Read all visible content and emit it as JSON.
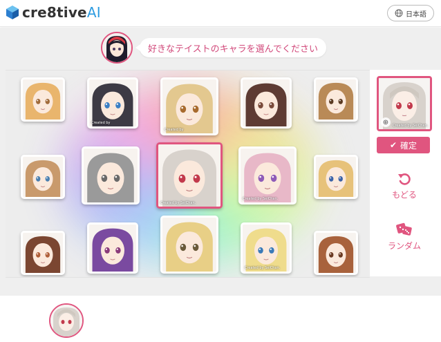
{
  "header": {
    "logo_text": "cre8tive",
    "logo_text_ai": "AI",
    "language_label": "日本語"
  },
  "prompt": {
    "message": "好きなテイストのキャラを選んでください"
  },
  "grid": {
    "cards": [
      {
        "id": "c1",
        "hair": "#e9b56d",
        "eye": "#a06a3a",
        "credit": ""
      },
      {
        "id": "c2",
        "hair": "#3d3a44",
        "eye": "#3b7fc4",
        "credit": "Created by"
      },
      {
        "id": "c3",
        "hair": "#e3c88f",
        "eye": "#a86b2f",
        "credit": "Created by"
      },
      {
        "id": "c4",
        "hair": "#5e3b33",
        "eye": "#7a4a3a",
        "credit": ""
      },
      {
        "id": "c5",
        "hair": "#b98a57",
        "eye": "#5b3a22",
        "credit": ""
      },
      {
        "id": "c6",
        "hair": "#c99a6c",
        "eye": "#4a7fb0",
        "credit": ""
      },
      {
        "id": "c7",
        "hair": "#9a9a9a",
        "eye": "#6a6a6a",
        "credit": ""
      },
      {
        "id": "c8",
        "hair": "#d8d2cc",
        "eye": "#c23a4c",
        "credit": "Created by SeiChan."
      },
      {
        "id": "c9",
        "hair": "#e8b8c8",
        "eye": "#8f5cb8",
        "credit": "Created by SeiChan."
      },
      {
        "id": "c10",
        "hair": "#e7c27a",
        "eye": "#3b62a7",
        "credit": ""
      },
      {
        "id": "c11",
        "hair": "#7b4631",
        "eye": "#b0603a",
        "credit": ""
      },
      {
        "id": "c12",
        "hair": "#7a4aa0",
        "eye": "#8a3a7a",
        "credit": ""
      },
      {
        "id": "c13",
        "hair": "#e8cf86",
        "eye": "#6a5a3a",
        "credit": ""
      },
      {
        "id": "c14",
        "hair": "#efdc8c",
        "eye": "#3a7ab8",
        "credit": "Created by SeiChan."
      },
      {
        "id": "c15",
        "hair": "#a8623c",
        "eye": "#6b3a22",
        "credit": ""
      }
    ]
  },
  "side": {
    "preview_credit": "Created by SeiChan.",
    "confirm_label": "確定",
    "back_label": "もどる",
    "random_label": "ランダム"
  },
  "colors": {
    "accent": "#e0557f",
    "brand_ai": "#2c9be0"
  }
}
